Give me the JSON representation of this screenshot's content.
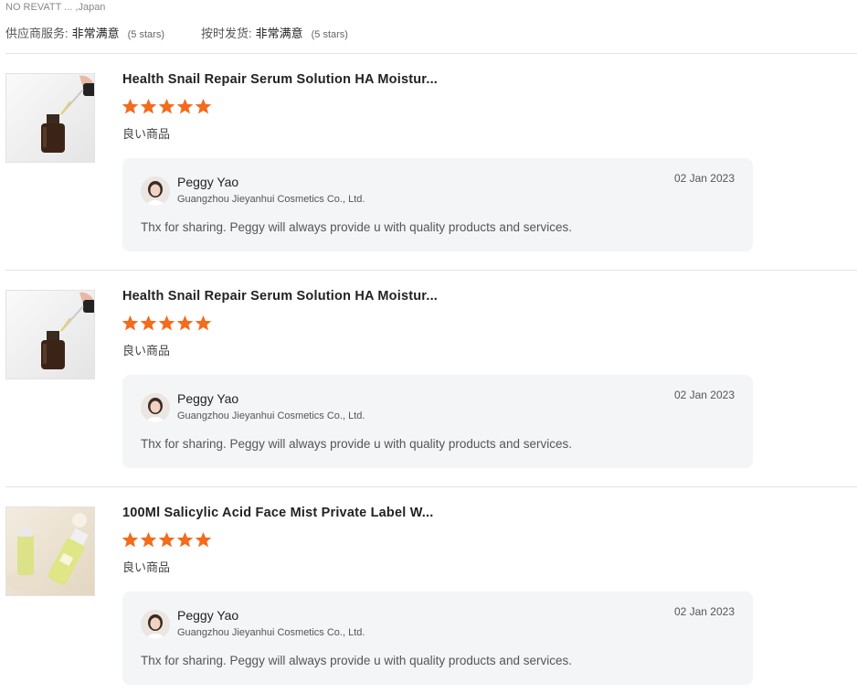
{
  "header": {
    "cut_text": "NO REVATT  ...  ,Japan",
    "supplier_service_label": "供应商服务:",
    "supplier_service_value": "非常满意",
    "supplier_service_stars": "(5 stars)",
    "shipping_label": "按时发货:",
    "shipping_value": "非常满意",
    "shipping_stars": "(5 stars)"
  },
  "colors": {
    "star": "#f36b1c",
    "reply_bg": "#f4f5f7",
    "divider": "#e3e3e3"
  },
  "reviews": [
    {
      "product_title": "Health Snail Repair Serum Solution HA Moistur...",
      "rating": 5,
      "comment": "良い商品",
      "thumb_icon": "serum-dropper-bottle",
      "reply": {
        "name": "Peggy Yao",
        "company": "Guangzhou Jieyanhui Cosmetics Co., Ltd.",
        "date": "02 Jan 2023",
        "text": "Thx for sharing. Peggy will always provide u with quality products and services."
      }
    },
    {
      "product_title": "Health Snail Repair Serum Solution HA Moistur...",
      "rating": 5,
      "comment": "良い商品",
      "thumb_icon": "serum-dropper-bottle",
      "reply": {
        "name": "Peggy Yao",
        "company": "Guangzhou Jieyanhui Cosmetics Co., Ltd.",
        "date": "02 Jan 2023",
        "text": "Thx for sharing. Peggy will always provide u with quality products and services."
      }
    },
    {
      "product_title": "100Ml Salicylic Acid Face Mist Private Label W...",
      "rating": 5,
      "comment": "良い商品",
      "thumb_icon": "face-mist-bottles",
      "reply": {
        "name": "Peggy Yao",
        "company": "Guangzhou Jieyanhui Cosmetics Co., Ltd.",
        "date": "02 Jan 2023",
        "text": "Thx for sharing. Peggy will always provide u with quality products and services."
      }
    }
  ]
}
